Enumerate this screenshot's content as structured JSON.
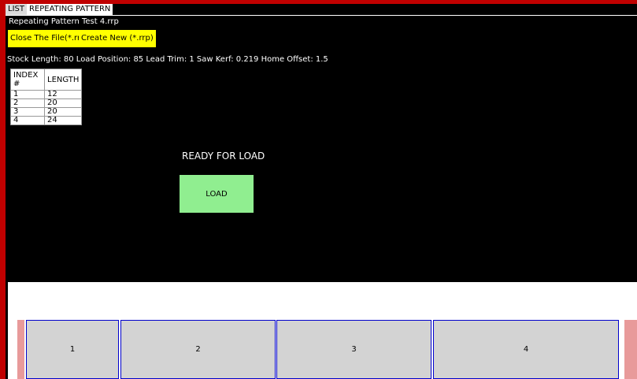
{
  "tabs": [
    {
      "label": "LIST",
      "active": false
    },
    {
      "label": "REPEATING PATTERN",
      "active": true
    }
  ],
  "file_name": "Repeating Pattern Test 4.rrp",
  "buttons": {
    "close_file": "Close The File(*.rrp)",
    "create_new": "Create New (*.rrp)",
    "load": "LOAD"
  },
  "params": {
    "text": "Stock Length:  80  Load Position:  85  Lead Trim:  1  Saw Kerf:  0.219  Home Offset:  1.5"
  },
  "table": {
    "headers": [
      "INDEX #",
      "LENGTH"
    ],
    "rows": [
      [
        "1",
        "12"
      ],
      [
        "2",
        "20"
      ],
      [
        "3",
        "20"
      ],
      [
        "4",
        "24"
      ]
    ]
  },
  "status": "READY FOR LOAD",
  "pieces": [
    {
      "label": "1"
    },
    {
      "label": "2"
    },
    {
      "label": "3"
    },
    {
      "label": "4"
    }
  ],
  "colors": {
    "accent_yellow": "#ffff00",
    "load_green": "#90ee90",
    "frame_red": "#c00000",
    "piece_border": "#0000cc"
  }
}
